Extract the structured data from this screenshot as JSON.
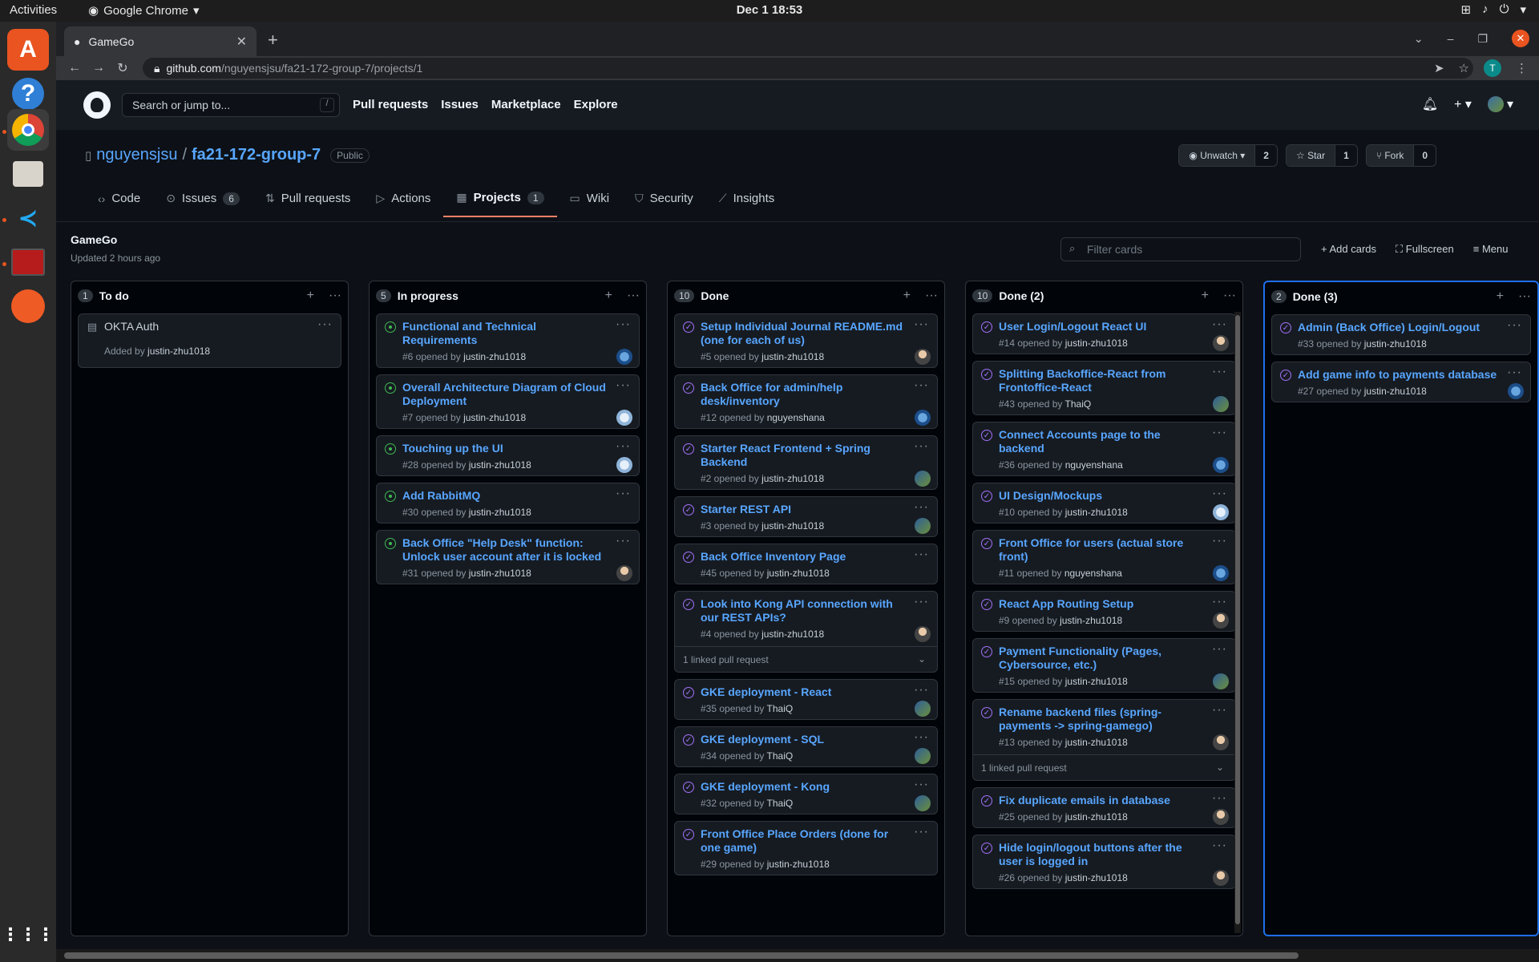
{
  "os": {
    "activities": "Activities",
    "app_name": "Google Chrome",
    "clock": "Dec 1  18:53"
  },
  "browser": {
    "tab_title": "GameGo",
    "url_host": "github.com",
    "url_path": "/nguyensjsu/fa21-172-group-7/projects/1",
    "profile_initial": "T"
  },
  "github": {
    "search_placeholder": "Search or jump to...",
    "search_key": "/",
    "nav": [
      "Pull requests",
      "Issues",
      "Marketplace",
      "Explore"
    ]
  },
  "repo": {
    "owner": "nguyensjsu",
    "name": "fa21-172-group-7",
    "visibility": "Public",
    "watch_label": "Unwatch",
    "watch_count": "2",
    "star_label": "Star",
    "star_count": "1",
    "fork_label": "Fork",
    "fork_count": "0",
    "tabs": [
      {
        "label": "Code",
        "icon": "code-icon"
      },
      {
        "label": "Issues",
        "icon": "issue-icon",
        "count": "6"
      },
      {
        "label": "Pull requests",
        "icon": "pull-request-icon"
      },
      {
        "label": "Actions",
        "icon": "play-icon"
      },
      {
        "label": "Projects",
        "icon": "project-icon",
        "count": "1"
      },
      {
        "label": "Wiki",
        "icon": "book-icon"
      },
      {
        "label": "Security",
        "icon": "shield-icon"
      },
      {
        "label": "Insights",
        "icon": "graph-icon"
      }
    ]
  },
  "project": {
    "title": "GameGo",
    "updated": "Updated 2 hours ago",
    "filter_placeholder": "Filter cards",
    "add_cards": "Add cards",
    "fullscreen": "Fullscreen",
    "menu": "Menu"
  },
  "columns": [
    {
      "name": "To do",
      "count": "1",
      "cards": [
        {
          "type": "note",
          "title": "OKTA Auth",
          "meta_prefix": "Added by ",
          "user": "justin-zhu1018"
        }
      ]
    },
    {
      "name": "In progress",
      "count": "5",
      "cards": [
        {
          "type": "open",
          "title": "Functional and Technical Requirements",
          "meta_prefix": "#6 opened by ",
          "user": "justin-zhu1018",
          "avatar": "a2"
        },
        {
          "type": "open",
          "title": "Overall Architecture Diagram of Cloud Deployment",
          "meta_prefix": "#7 opened by ",
          "user": "justin-zhu1018",
          "avatar": "a3"
        },
        {
          "type": "open",
          "title": "Touching up the UI",
          "meta_prefix": "#28 opened by ",
          "user": "justin-zhu1018",
          "avatar": "a3"
        },
        {
          "type": "open",
          "title": "Add RabbitMQ",
          "meta_prefix": "#30 opened by ",
          "user": "justin-zhu1018"
        },
        {
          "type": "open",
          "title": "Back Office \"Help Desk\" function: Unlock user account after it is locked",
          "meta_prefix": "#31 opened by ",
          "user": "justin-zhu1018",
          "avatar": "a1"
        }
      ]
    },
    {
      "name": "Done",
      "count": "10",
      "cards": [
        {
          "type": "closed",
          "title": "Setup Individual Journal README.md (one for each of us)",
          "meta_prefix": "#5 opened by ",
          "user": "justin-zhu1018",
          "avatar": "a1"
        },
        {
          "type": "closed",
          "title": "Back Office for admin/help desk/inventory",
          "meta_prefix": "#12 opened by ",
          "user": "nguyenshana",
          "avatar": "a2"
        },
        {
          "type": "closed",
          "title": "Starter React Frontend + Spring Backend",
          "meta_prefix": "#2 opened by ",
          "user": "justin-zhu1018",
          "avatar": "a4"
        },
        {
          "type": "closed",
          "title": "Starter REST API",
          "meta_prefix": "#3 opened by ",
          "user": "justin-zhu1018",
          "avatar": "a4"
        },
        {
          "type": "closed",
          "title": "Back Office Inventory Page",
          "meta_prefix": "#45 opened by ",
          "user": "justin-zhu1018"
        },
        {
          "type": "closed",
          "title": "Look into Kong API connection with our REST APIs?",
          "meta_prefix": "#4 opened by ",
          "user": "justin-zhu1018",
          "avatar": "a1",
          "linked": "1 linked pull request"
        },
        {
          "type": "closed",
          "title": "GKE deployment - React",
          "meta_prefix": "#35 opened by ",
          "user": "ThaiQ",
          "avatar": "a4"
        },
        {
          "type": "closed",
          "title": "GKE deployment - SQL",
          "meta_prefix": "#34 opened by ",
          "user": "ThaiQ",
          "avatar": "a4"
        },
        {
          "type": "closed",
          "title": "GKE deployment - Kong",
          "meta_prefix": "#32 opened by ",
          "user": "ThaiQ",
          "avatar": "a4"
        },
        {
          "type": "closed",
          "title": "Front Office Place Orders (done for one game)",
          "meta_prefix": "#29 opened by ",
          "user": "justin-zhu1018"
        }
      ]
    },
    {
      "name": "Done (2)",
      "count": "10",
      "cards": [
        {
          "type": "closed",
          "title": "User Login/Logout React UI",
          "meta_prefix": "#14 opened by ",
          "user": "justin-zhu1018",
          "avatar": "a1"
        },
        {
          "type": "closed",
          "title": "Splitting Backoffice-React from Frontoffice-React",
          "meta_prefix": "#43 opened by ",
          "user": "ThaiQ",
          "avatar": "a4"
        },
        {
          "type": "closed",
          "title": "Connect Accounts page to the backend",
          "meta_prefix": "#36 opened by ",
          "user": "nguyenshana",
          "avatar": "a2"
        },
        {
          "type": "closed",
          "title": "UI Design/Mockups",
          "meta_prefix": "#10 opened by ",
          "user": "justin-zhu1018",
          "avatar": "a3"
        },
        {
          "type": "closed",
          "title": "Front Office for users (actual store front)",
          "meta_prefix": "#11 opened by ",
          "user": "nguyenshana",
          "avatar": "a2"
        },
        {
          "type": "closed",
          "title": "React App Routing Setup",
          "meta_prefix": "#9 opened by ",
          "user": "justin-zhu1018",
          "avatar": "a1"
        },
        {
          "type": "closed",
          "title": "Payment Functionality (Pages, Cybersource, etc.)",
          "meta_prefix": "#15 opened by ",
          "user": "justin-zhu1018",
          "avatar": "a4"
        },
        {
          "type": "closed",
          "title": "Rename backend files (spring-payments -> spring-gamego)",
          "meta_prefix": "#13 opened by ",
          "user": "justin-zhu1018",
          "avatar": "a1",
          "linked": "1 linked pull request"
        },
        {
          "type": "closed",
          "title": "Fix duplicate emails in database",
          "meta_prefix": "#25 opened by ",
          "user": "justin-zhu1018",
          "avatar": "a1"
        },
        {
          "type": "closed",
          "title": "Hide login/logout buttons after the user is logged in",
          "meta_prefix": "#26 opened by ",
          "user": "justin-zhu1018",
          "avatar": "a1"
        }
      ]
    },
    {
      "name": "Done (3)",
      "count": "2",
      "cards": [
        {
          "type": "closed",
          "title": "Admin (Back Office) Login/Logout",
          "meta_prefix": "#33 opened by ",
          "user": "justin-zhu1018"
        },
        {
          "type": "closed",
          "title": "Add game info to payments database",
          "meta_prefix": "#27 opened by ",
          "user": "justin-zhu1018",
          "avatar": "a2"
        }
      ]
    }
  ]
}
